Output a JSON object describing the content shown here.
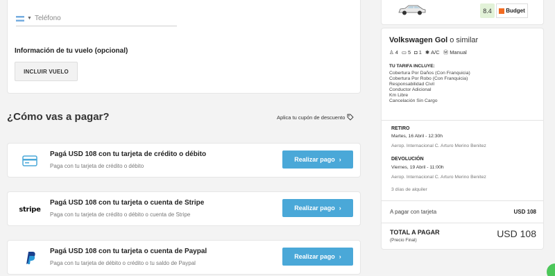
{
  "contact": {
    "phone_placeholder": "Teléfono"
  },
  "flight": {
    "title": "Información de tu vuelo (opcional)",
    "button": "INCLUIR VUELO"
  },
  "payment": {
    "title": "¿Cómo vas a pagar?",
    "coupon": "Aplica tu cupón de descuento",
    "options": [
      {
        "icon": "credit-card-icon",
        "title": "Pagá USD 108 con tu tarjeta de crédito o débito",
        "subtitle": "Paga con tu tarjeta de crédito o débito",
        "button": "Realizar pago"
      },
      {
        "icon": "stripe-logo",
        "logo_text": "stripe",
        "title": "Pagá USD 108 con tu tarjeta o cuenta de Stripe",
        "subtitle": "Paga con tu tarjeta de crédito o débito o cuenta de Stripe",
        "button": "Realizar pago"
      },
      {
        "icon": "paypal-icon",
        "title": "Pagá USD 108 con tu tarjeta o cuenta de Paypal",
        "subtitle": "Paga con tu tarjeta de débito o crédito o tu saldo de Paypal",
        "button": "Realizar pago"
      }
    ],
    "button_color": "#4aa8d8"
  },
  "rental": {
    "score": "8.4",
    "company": "Budget",
    "car_name": "Volkswagen Gol",
    "car_suffix": "o similar",
    "features": {
      "passengers": "4",
      "doors": "5",
      "bags": "1",
      "ac": "A/C",
      "transmission": "Manual"
    },
    "tarifa_title": "TU TARIFA INCLUYE:",
    "tarifa_items": [
      "Cobertura Por Daños (Con Franquicia)",
      "Cobertura Por Robo (Con Franquicia)",
      "Responsabilidad Civil",
      "Conductor Adicional",
      "Km Libre",
      "Cancelación Sin Cargo"
    ],
    "pickup": {
      "label": "RETIRO",
      "date": "Martes, 16 Abril - 12:30h",
      "place": "Aerop. Internacional C. Arturo Merino Benitez"
    },
    "dropoff": {
      "label": "DEVOLUCIÓN",
      "date": "Viernes, 19 Abril - 11:00h",
      "place": "Aerop. Internacional C. Arturo Merino Benitez"
    },
    "days": "3 días de alquiler",
    "card_label": "A pagar con tarjeta",
    "card_amount": "USD 108",
    "total_label": "TOTAL A PAGAR",
    "total_sub": "(Precio Final)",
    "total_amount": "USD 108"
  }
}
